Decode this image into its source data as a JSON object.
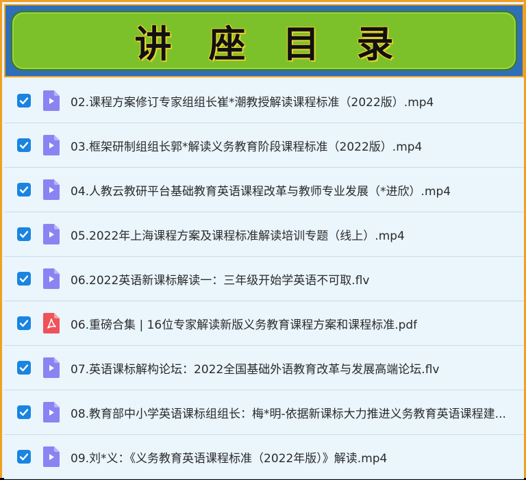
{
  "banner": {
    "title": "讲座目录"
  },
  "files": [
    {
      "name": "02.课程方案修订专家组组长崔*潮教授解读课程标准（2022版）.mp4",
      "type": "video",
      "checked": true
    },
    {
      "name": "03.框架研制组组长郭*解读义务教育阶段课程标准（2022版）.mp4",
      "type": "video",
      "checked": true
    },
    {
      "name": "04.人教云教研平台基础教育英语课程改革与教师专业发展（*进欣）.mp4",
      "type": "video",
      "checked": true
    },
    {
      "name": "05.2022年上海课程方案及课程标准解读培训专题（线上）.mp4",
      "type": "video",
      "checked": true
    },
    {
      "name": "06.2022英语新课标解读一：三年级开始学英语不可取.flv",
      "type": "video",
      "checked": true
    },
    {
      "name": "06.重磅合集 | 16位专家解读新版义务教育课程方案和课程标准.pdf",
      "type": "pdf",
      "checked": true
    },
    {
      "name": "07.英语课标解构论坛：2022全国基础外语教育改革与发展高端论坛.flv",
      "type": "video",
      "checked": true
    },
    {
      "name": "08.教育部中小学英语课标组组长：梅*明-依据新课标大力推进义务教育英语课程建...",
      "type": "video",
      "checked": true
    },
    {
      "name": "09.刘*义：《义务教育英语课程标准（2022年版）》解读.mp4",
      "type": "video",
      "checked": true
    }
  ],
  "colors": {
    "checkbox": "#1a84e0",
    "video_icon": "#8a83f2",
    "pdf_icon": "#f0525a",
    "banner_green": "#7cc12a",
    "banner_blue": "#2f6fb8"
  },
  "icons": {
    "checkbox": "check-icon",
    "video": "video-file-icon",
    "pdf": "pdf-file-icon"
  }
}
